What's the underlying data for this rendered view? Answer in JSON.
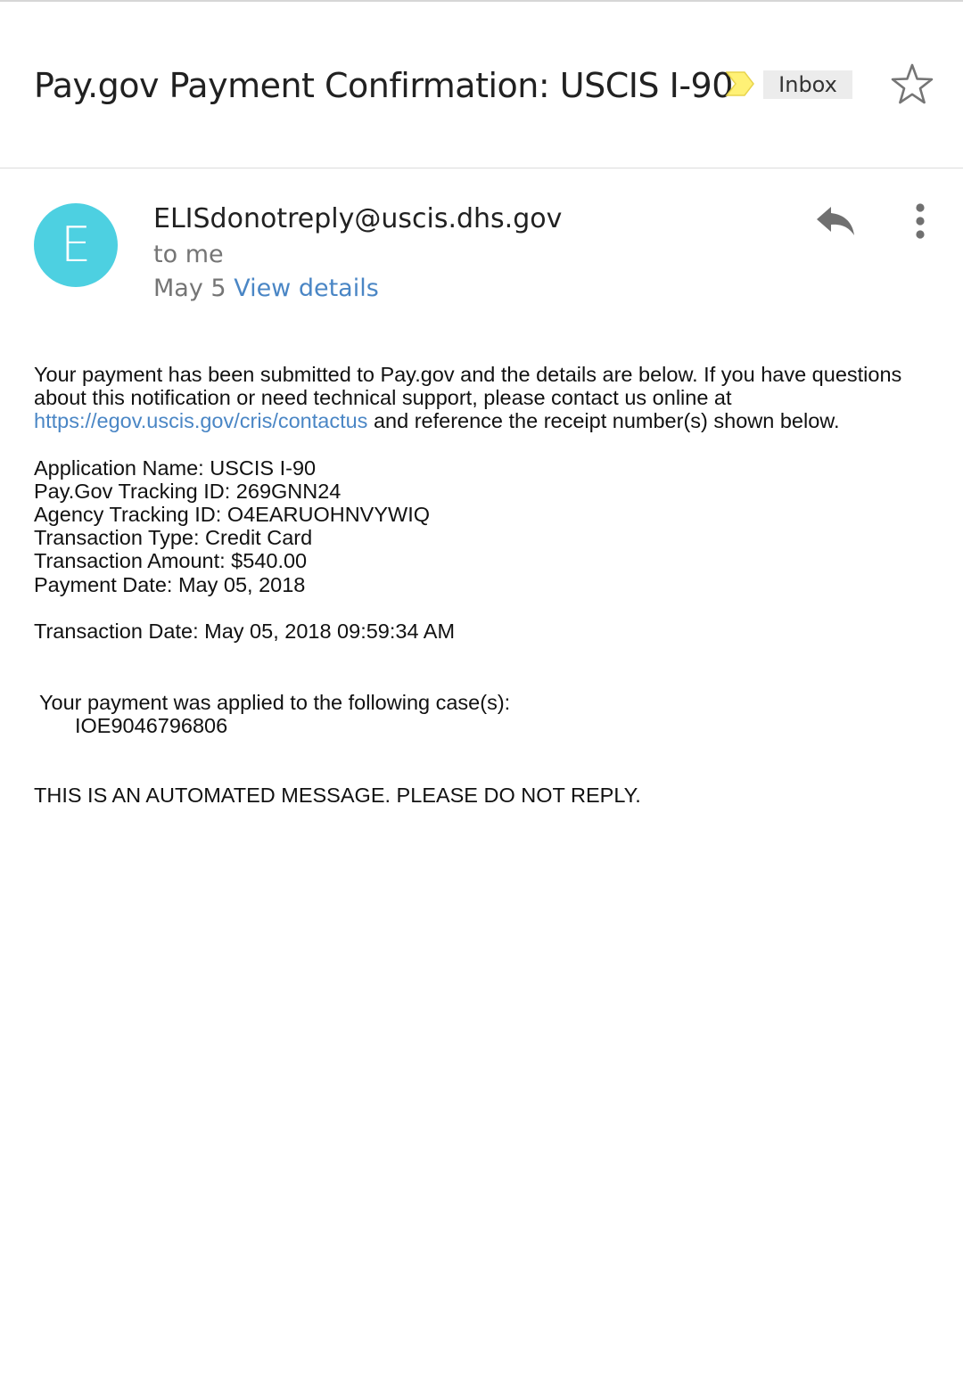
{
  "subject": {
    "title": "Pay.gov Payment Confirmation: USCIS I-90",
    "label": "Inbox",
    "importance_marker_color": "#fff176",
    "star_icon": "star-outline-icon"
  },
  "sender": {
    "avatar_letter": "E",
    "avatar_color": "#4dd0e1",
    "email": "ELISdonotreply@uscis.dhs.gov",
    "recipient": "to me",
    "date": "May 5",
    "view_details": "View details",
    "reply_icon": "reply-icon",
    "more_icon": "more-vert-icon"
  },
  "body": {
    "intro_before_link": "Your payment has been submitted to Pay.gov and the details are below. If you have questions about this notification or need technical support, please contact us online at ",
    "link": "https://egov.uscis.gov/cris/contactus",
    "intro_after_link": " and reference the receipt number(s) shown below.",
    "details": [
      "Application Name: USCIS I-90",
      "Pay.Gov Tracking ID: 269GNN24",
      "Agency Tracking ID: O4EARUOHNVYWIQ",
      "Transaction Type: Credit Card",
      "Transaction Amount: $540.00",
      "Payment Date: May 05, 2018"
    ],
    "transaction_date": "Transaction Date: May 05, 2018 09:59:34 AM",
    "applied_label": "Your payment was applied to the following case(s):",
    "case_number": "IOE9046796806",
    "automated_notice": "THIS IS AN AUTOMATED MESSAGE.  PLEASE DO NOT REPLY."
  },
  "colors": {
    "link": "#4a86c5",
    "secondary_text": "#757575",
    "icon": "#757575"
  }
}
